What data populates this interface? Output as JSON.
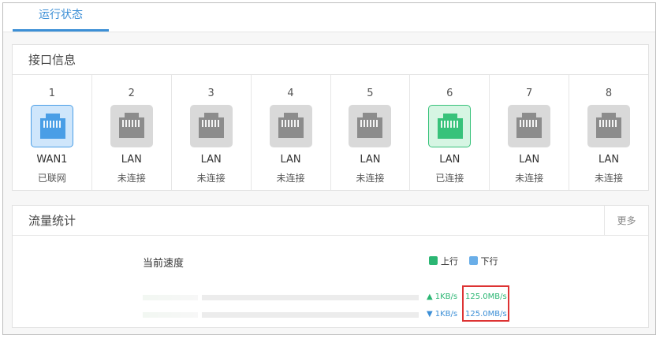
{
  "tab": {
    "label": "运行状态"
  },
  "interfaces": {
    "title": "接口信息",
    "ports": [
      {
        "num": "1",
        "type": "WAN1",
        "status": "已联网",
        "state": "wan"
      },
      {
        "num": "2",
        "type": "LAN",
        "status": "未连接",
        "state": "off"
      },
      {
        "num": "3",
        "type": "LAN",
        "status": "未连接",
        "state": "off"
      },
      {
        "num": "4",
        "type": "LAN",
        "status": "未连接",
        "state": "off"
      },
      {
        "num": "5",
        "type": "LAN",
        "status": "未连接",
        "state": "off"
      },
      {
        "num": "6",
        "type": "LAN",
        "status": "已连接",
        "state": "up"
      },
      {
        "num": "7",
        "type": "LAN",
        "status": "未连接",
        "state": "off"
      },
      {
        "num": "8",
        "type": "LAN",
        "status": "未连接",
        "state": "off"
      }
    ]
  },
  "traffic": {
    "title": "流量统计",
    "more": "更多",
    "speed_label": "当前速度",
    "legend": {
      "up": "上行",
      "down": "下行"
    },
    "upload": {
      "rate": "1KB/s",
      "max": "125.0MB/s",
      "fill": 0.0
    },
    "download": {
      "rate": "1KB/s",
      "max": "125.0MB/s",
      "fill": 0.0
    }
  },
  "colors": {
    "accent": "#3c8fd6",
    "up": "#2bb673",
    "down": "#6aaee8",
    "wan_icon": "#4a9ee6",
    "connected_icon": "#37c27a",
    "inactive_icon": "#8c8c8c",
    "highlight": "#dd3333"
  },
  "icons": {
    "port": "ethernet-port-icon"
  }
}
